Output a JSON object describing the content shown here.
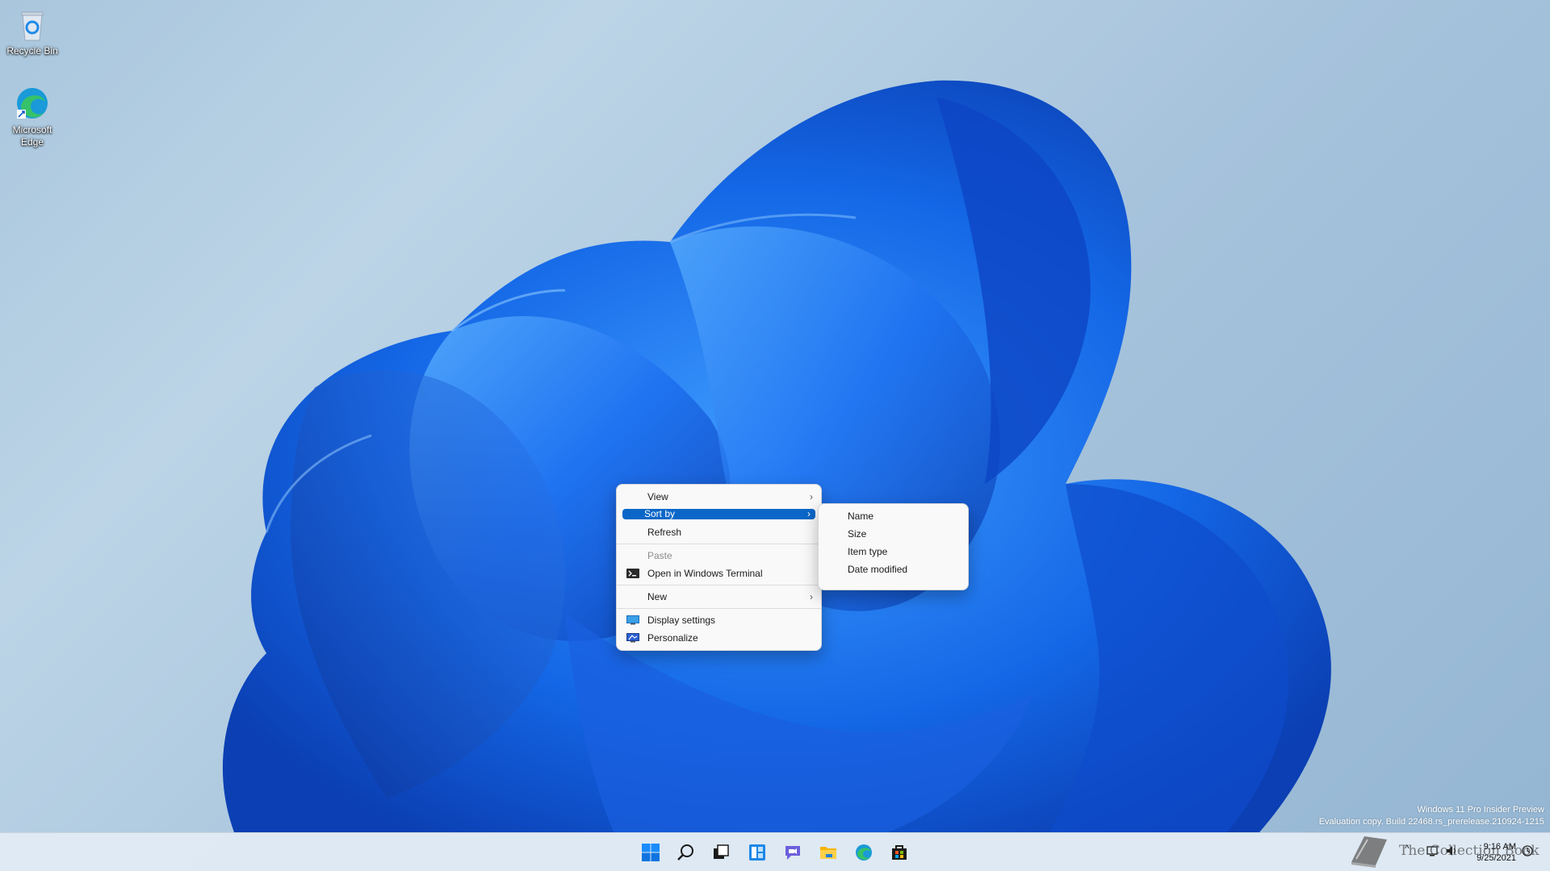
{
  "desktop": {
    "icons": [
      {
        "label": "Recycle Bin"
      },
      {
        "label": "Microsoft Edge"
      }
    ]
  },
  "context_menu": {
    "items": [
      {
        "label": "View",
        "has_submenu": true
      },
      {
        "label": "Sort by",
        "has_submenu": true,
        "highlighted": true
      },
      {
        "label": "Refresh"
      },
      {
        "label": "Paste",
        "disabled": true
      },
      {
        "label": "Open in Windows Terminal",
        "icon": "terminal-icon"
      },
      {
        "label": "New",
        "has_submenu": true
      },
      {
        "label": "Display settings",
        "icon": "display-icon"
      },
      {
        "label": "Personalize",
        "icon": "personalize-icon"
      }
    ],
    "chevron": "›"
  },
  "sort_submenu": {
    "items": [
      {
        "label": "Name"
      },
      {
        "label": "Size"
      },
      {
        "label": "Item type"
      },
      {
        "label": "Date modified"
      }
    ]
  },
  "watermark": {
    "line1": "Windows 11 Pro Insider Preview",
    "line2": "Evaluation copy. Build 22468.rs_prerelease.210924-1215"
  },
  "taskbar": {
    "apps": [
      "start-icon",
      "search-icon",
      "task-view-icon",
      "widgets-icon",
      "chat-icon",
      "file-explorer-icon",
      "edge-icon",
      "store-icon"
    ],
    "tray_chevron": "^",
    "time": "9:16 AM",
    "date": "9/25/2021",
    "overlay_text": "The Collection Book"
  },
  "colors": {
    "menu_highlight": "#0a67c8",
    "accent": "#0078d4"
  }
}
